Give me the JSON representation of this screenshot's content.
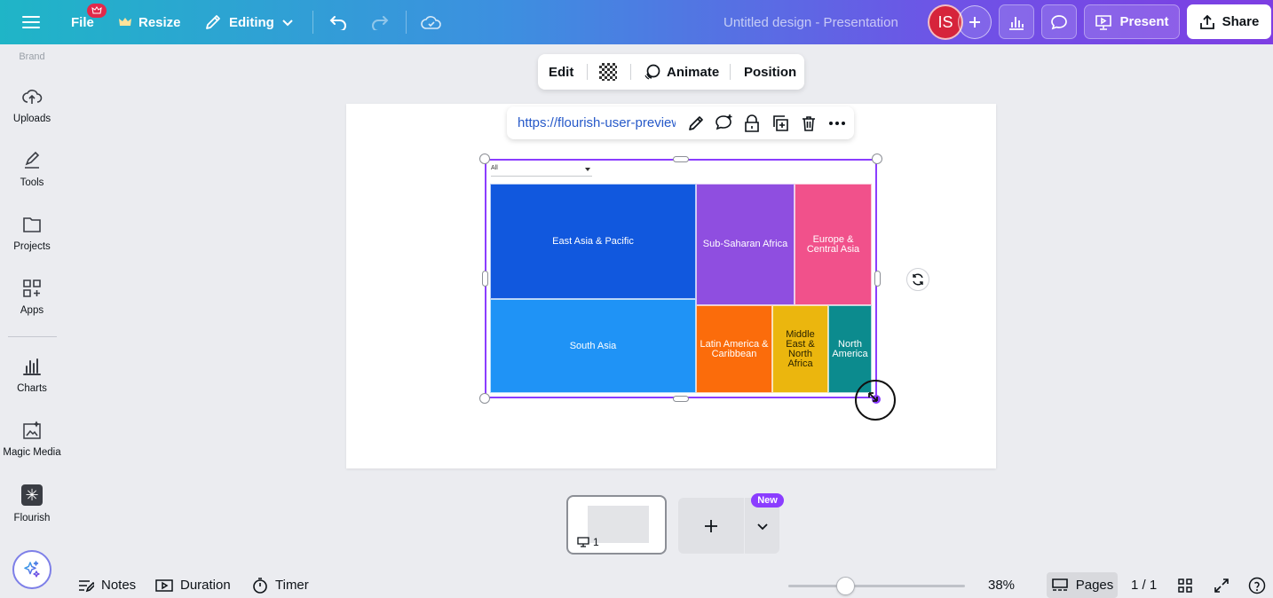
{
  "topbar": {
    "file_label": "File",
    "resize_label": "Resize",
    "editing_label": "Editing",
    "title": "Untitled design - Presentation",
    "avatar_initials": "IS",
    "present_label": "Present",
    "share_label": "Share",
    "accent_color": "#8b3dff"
  },
  "sidebar": {
    "items": [
      {
        "label": "Brand",
        "icon": "brand-icon"
      },
      {
        "label": "Uploads",
        "icon": "upload-cloud-icon"
      },
      {
        "label": "Tools",
        "icon": "pen-tool-icon"
      },
      {
        "label": "Projects",
        "icon": "folder-icon"
      },
      {
        "label": "Apps",
        "icon": "apps-grid-icon"
      },
      {
        "label": "Charts",
        "icon": "bar-chart-icon"
      },
      {
        "label": "Magic Media",
        "icon": "magic-image-icon"
      },
      {
        "label": "Flourish",
        "icon": "flourish-icon"
      }
    ]
  },
  "context_toolbar": {
    "edit_label": "Edit",
    "animate_label": "Animate",
    "position_label": "Position"
  },
  "embed_toolbar": {
    "url": "https://flourish-user-preview"
  },
  "chart": {
    "dropdown_value": "All"
  },
  "chart_data": {
    "type": "treemap",
    "categories": [
      "East Asia & Pacific",
      "South Asia",
      "Sub-Saharan Africa",
      "Europe & Central Asia",
      "Latin America & Caribbean",
      "Middle East & North Africa",
      "North America"
    ],
    "colors": [
      "#1158de",
      "#1f93f6",
      "#8f4ee0",
      "#f1518b",
      "#fb6c0b",
      "#ebb60e",
      "#0c8b8e"
    ],
    "values": [
      23.5,
      18.2,
      11.3,
      7.9,
      6.5,
      4.3,
      3.6
    ]
  },
  "pages": {
    "thumb_number": "1",
    "new_badge": "New"
  },
  "bottombar": {
    "notes_label": "Notes",
    "duration_label": "Duration",
    "timer_label": "Timer",
    "zoom_value": 38,
    "zoom_label": "38%",
    "pages_label": "Pages",
    "page_count": "1 / 1"
  }
}
